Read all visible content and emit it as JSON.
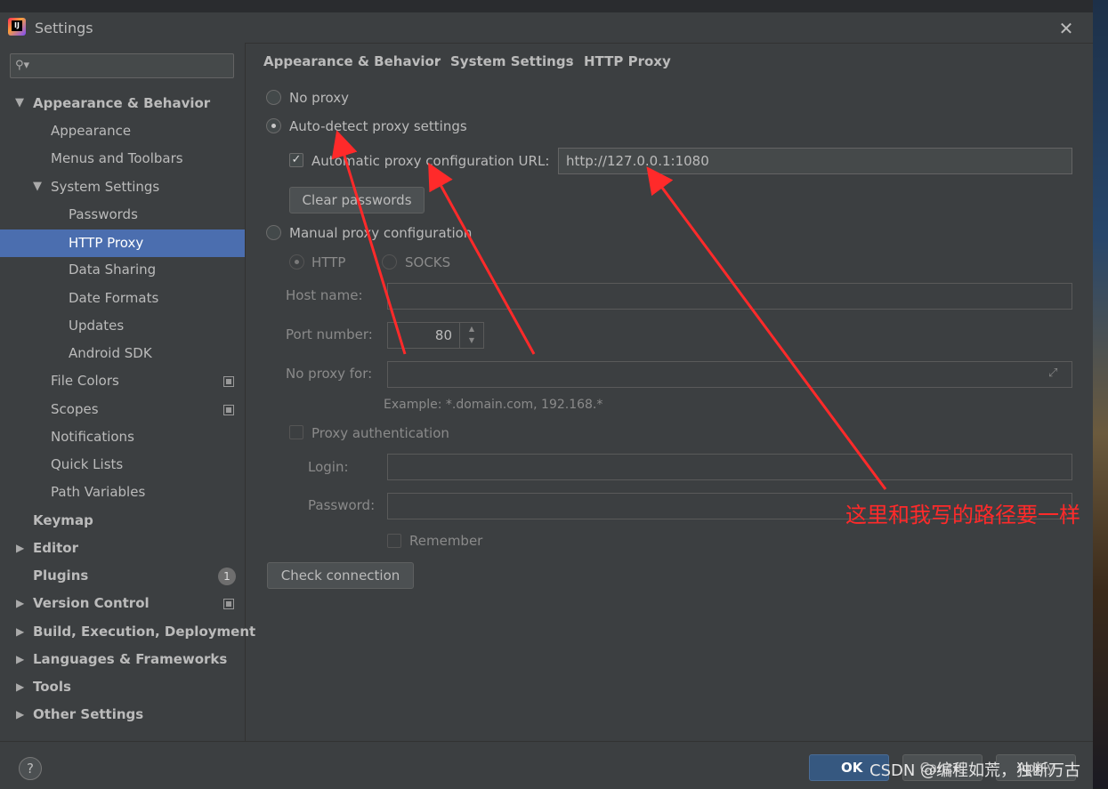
{
  "window": {
    "title": "Settings"
  },
  "search": {
    "placeholder": ""
  },
  "tree": {
    "appearance_behavior": "Appearance & Behavior",
    "appearance": "Appearance",
    "menus_toolbars": "Menus and Toolbars",
    "system_settings": "System Settings",
    "passwords": "Passwords",
    "http_proxy": "HTTP Proxy",
    "data_sharing": "Data Sharing",
    "date_formats": "Date Formats",
    "updates": "Updates",
    "android_sdk": "Android SDK",
    "file_colors": "File Colors",
    "scopes": "Scopes",
    "notifications": "Notifications",
    "quick_lists": "Quick Lists",
    "path_variables": "Path Variables",
    "keymap": "Keymap",
    "editor": "Editor",
    "plugins": "Plugins",
    "plugins_badge": "1",
    "version_control": "Version Control",
    "build": "Build, Execution, Deployment",
    "languages": "Languages & Frameworks",
    "tools": "Tools",
    "other_settings": "Other Settings"
  },
  "breadcrumb": {
    "item1": "Appearance & Behavior",
    "item2": "System Settings",
    "item3": "HTTP Proxy",
    "separator": "›"
  },
  "proxy": {
    "no_proxy": "No proxy",
    "auto_detect": "Auto-detect proxy settings",
    "auto_config_url_label": "Automatic proxy configuration URL:",
    "auto_config_url_value": "http://127.0.0.1:1080",
    "clear_passwords": "Clear passwords",
    "manual": "Manual proxy configuration",
    "http": "HTTP",
    "socks": "SOCKS",
    "host_label": "Host name:",
    "host_value": "",
    "port_label": "Port number:",
    "port_value": "80",
    "no_proxy_for_label": "No proxy for:",
    "no_proxy_for_value": "",
    "example": "Example: *.domain.com, 192.168.*",
    "proxy_auth": "Proxy authentication",
    "login_label": "Login:",
    "login_value": "",
    "password_label": "Password:",
    "password_value": "",
    "remember": "Remember",
    "check_connection": "Check connection"
  },
  "footer": {
    "help": "?",
    "ok": "OK",
    "cancel": "Cancel",
    "apply": "Apply"
  },
  "annotation": {
    "text": "这里和我写的路径要一样",
    "color": "#ff2a2a"
  },
  "watermark": "CSDN @编程如荒，独断万古",
  "colors": {
    "background": "#3c3f41",
    "selection": "#4b6eaf",
    "ok_button": "#365880"
  }
}
